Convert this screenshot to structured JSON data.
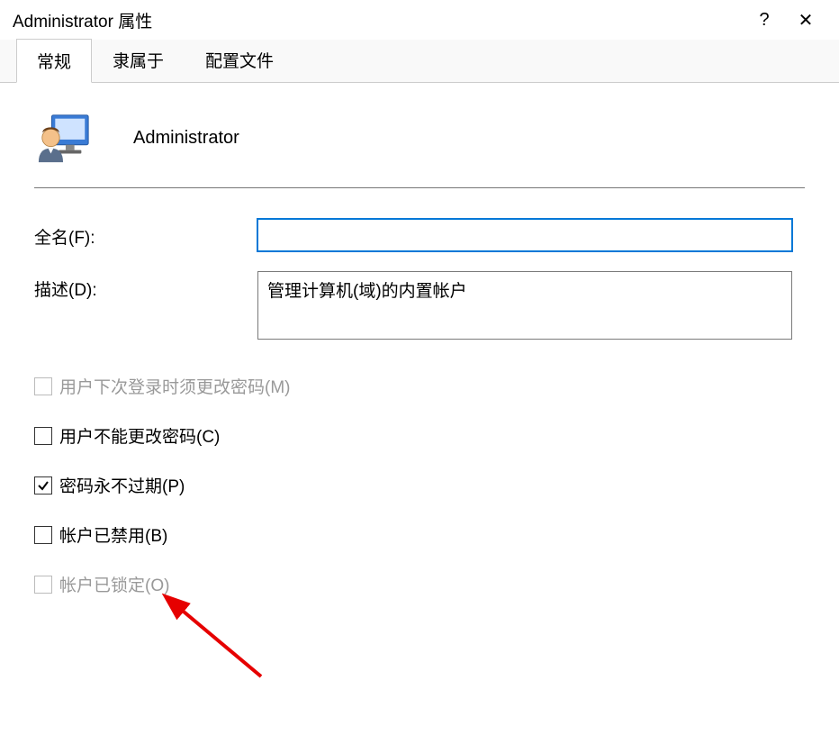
{
  "titlebar": {
    "title": "Administrator 属性",
    "help": "?",
    "close": "✕"
  },
  "tabs": [
    {
      "label": "常规",
      "active": true
    },
    {
      "label": "隶属于",
      "active": false
    },
    {
      "label": "配置文件",
      "active": false
    }
  ],
  "header": {
    "username": "Administrator"
  },
  "form": {
    "fullname_label": "全名(F):",
    "fullname_value": "",
    "description_label": "描述(D):",
    "description_value": "管理计算机(域)的内置帐户"
  },
  "checkboxes": [
    {
      "label": "用户下次登录时须更改密码(M)",
      "checked": false,
      "disabled": true
    },
    {
      "label": "用户不能更改密码(C)",
      "checked": false,
      "disabled": false
    },
    {
      "label": "密码永不过期(P)",
      "checked": true,
      "disabled": false
    },
    {
      "label": "帐户已禁用(B)",
      "checked": false,
      "disabled": false
    },
    {
      "label": "帐户已锁定(O)",
      "checked": false,
      "disabled": true
    }
  ]
}
